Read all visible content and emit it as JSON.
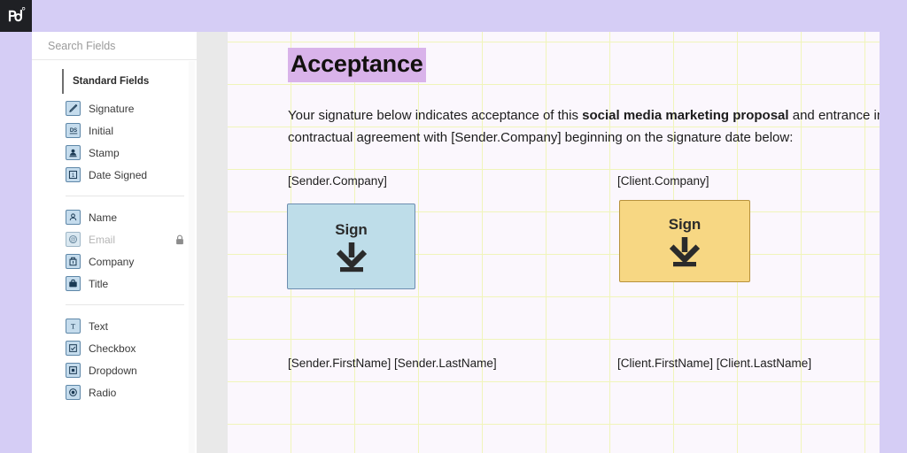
{
  "app": {
    "logo": "pandadoc-logo",
    "logo_text": "pd"
  },
  "rail": {
    "items": [
      {
        "icon": "field-rectangle-icon",
        "name": "content-tool"
      },
      {
        "icon": "signature-tool-icon",
        "name": "fields-tool"
      }
    ]
  },
  "panel": {
    "search": {
      "placeholder": "Search Fields",
      "value": "",
      "search_icon": "search-icon",
      "close_icon": "close-icon"
    },
    "section": {
      "checkbox_icon": "checkbox-empty-icon",
      "title": "Standard Fields"
    },
    "groups": [
      {
        "fields": [
          {
            "label": "Signature",
            "icon": "signature-icon",
            "disabled": false,
            "locked": false
          },
          {
            "label": "Initial",
            "icon": "initial-icon",
            "disabled": false,
            "locked": false
          },
          {
            "label": "Stamp",
            "icon": "stamp-icon",
            "disabled": false,
            "locked": false
          },
          {
            "label": "Date Signed",
            "icon": "date-signed-icon",
            "disabled": false,
            "locked": false
          }
        ]
      },
      {
        "fields": [
          {
            "label": "Name",
            "icon": "name-icon",
            "disabled": false,
            "locked": false
          },
          {
            "label": "Email",
            "icon": "email-icon",
            "disabled": true,
            "locked": true
          },
          {
            "label": "Company",
            "icon": "company-icon",
            "disabled": false,
            "locked": false
          },
          {
            "label": "Title",
            "icon": "title-icon",
            "disabled": false,
            "locked": false
          }
        ]
      },
      {
        "fields": [
          {
            "label": "Text",
            "icon": "text-icon",
            "disabled": false,
            "locked": false
          },
          {
            "label": "Checkbox",
            "icon": "checkbox-icon",
            "disabled": false,
            "locked": false
          },
          {
            "label": "Dropdown",
            "icon": "dropdown-icon",
            "disabled": false,
            "locked": false
          },
          {
            "label": "Radio",
            "icon": "radio-icon",
            "disabled": false,
            "locked": false
          }
        ]
      }
    ]
  },
  "document": {
    "title": "Acceptance",
    "paragraph": {
      "before_bold": "Your signature below indicates acceptance of this ",
      "bold": "social media marketing proposal",
      "after_bold": " and entrance into a contractual agreement with [Sender.Company] beginning on the signature date below:"
    },
    "sender": {
      "company": "[Sender.Company]",
      "sign_label": "Sign",
      "sign_icon": "sign-download-arrow-icon",
      "name": "[Sender.FirstName] [Sender.LastName]"
    },
    "client": {
      "company": "[Client.Company]",
      "sign_label": "Sign",
      "sign_icon": "sign-download-arrow-icon",
      "name": "[Client.FirstName] [Client.LastName]"
    }
  },
  "colors": {
    "app_background": "#d5cdf5",
    "page_background": "#fbf7fd",
    "grid_line": "#f0f5ba",
    "title_highlight": "#d9b3ea",
    "sender_box_fill": "#bedde9",
    "sender_box_border": "#6c8db0",
    "client_box_fill": "#f7d783",
    "client_box_border": "#b8923c",
    "field_icon_fill": "#c5dced",
    "field_icon_border": "#5e87a8"
  }
}
